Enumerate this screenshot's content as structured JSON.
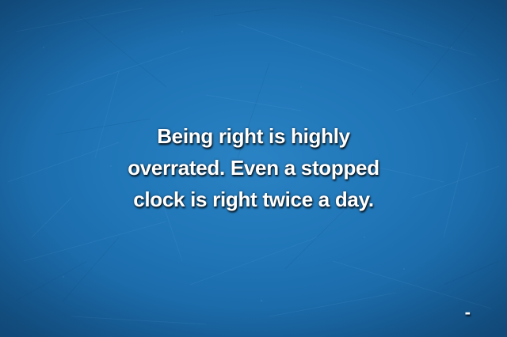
{
  "quote": {
    "lines": [
      "Being right is highly",
      "overrated. Even a stopped",
      "clock is right twice a day."
    ]
  },
  "author": {
    "text": "-"
  },
  "colors": {
    "background": "#1f75b6",
    "text": "#ffffff"
  }
}
